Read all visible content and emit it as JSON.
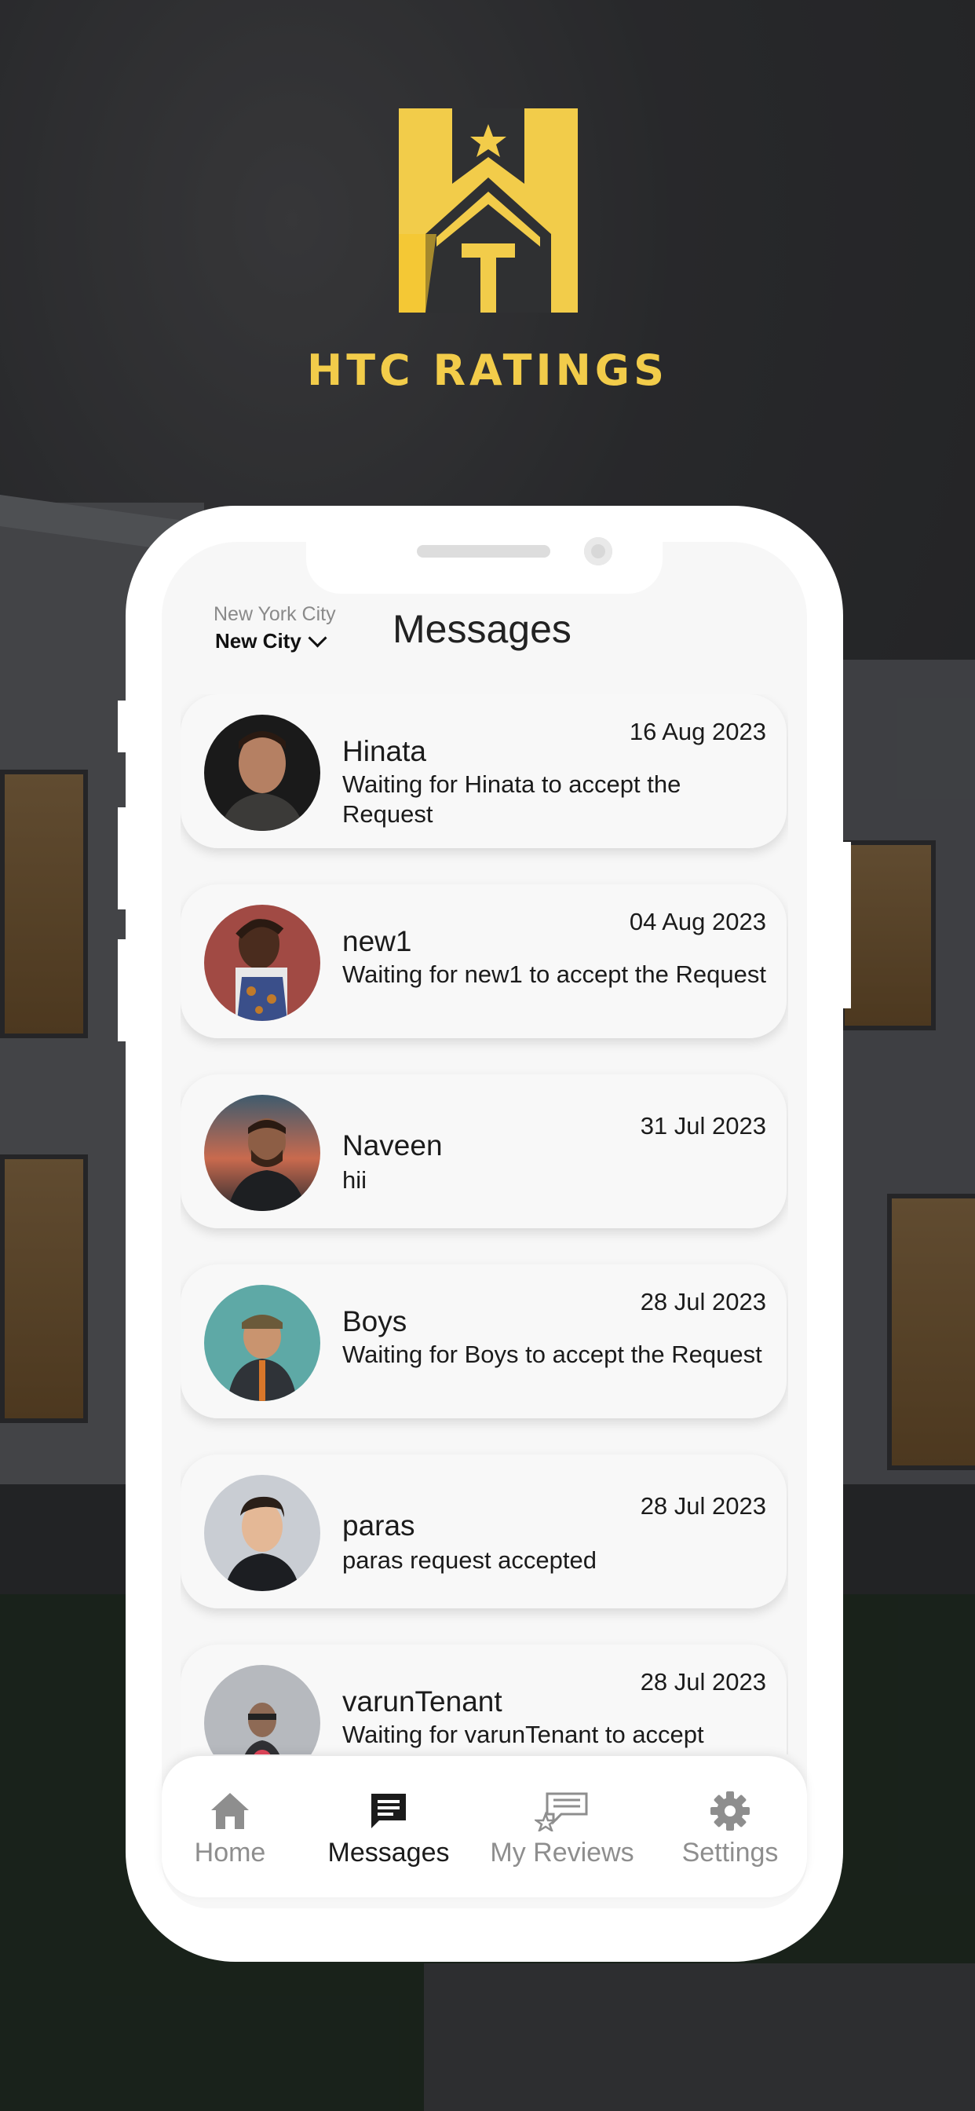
{
  "brand": {
    "name": "HTC RATINGS",
    "logo_icon": "house-star-logo-icon",
    "accent": "#F2CC4A"
  },
  "header": {
    "location_label": "New York City",
    "city_select": "New City",
    "title": "Messages"
  },
  "messages": [
    {
      "name": "Hinata",
      "date": "16 Aug 2023",
      "text": "Waiting for Hinata to accept the Request"
    },
    {
      "name": "new1",
      "date": "04 Aug 2023",
      "text": "Waiting for new1 to accept the Request"
    },
    {
      "name": "Naveen",
      "date": "31 Jul 2023",
      "text": "hii"
    },
    {
      "name": "Boys",
      "date": "28 Jul 2023",
      "text": "Waiting for Boys to accept the Request"
    },
    {
      "name": "paras",
      "date": "28 Jul 2023",
      "text": "paras request accepted"
    },
    {
      "name": "varunTenant",
      "date": "28 Jul 2023",
      "text": "Waiting for varunTenant to accept"
    }
  ],
  "tabs": [
    {
      "label": "Home",
      "icon": "home-icon",
      "active": false
    },
    {
      "label": "Messages",
      "icon": "chat-icon",
      "active": true
    },
    {
      "label": "My Reviews",
      "icon": "reviews-icon",
      "active": false
    },
    {
      "label": "Settings",
      "icon": "gear-icon",
      "active": false
    }
  ]
}
